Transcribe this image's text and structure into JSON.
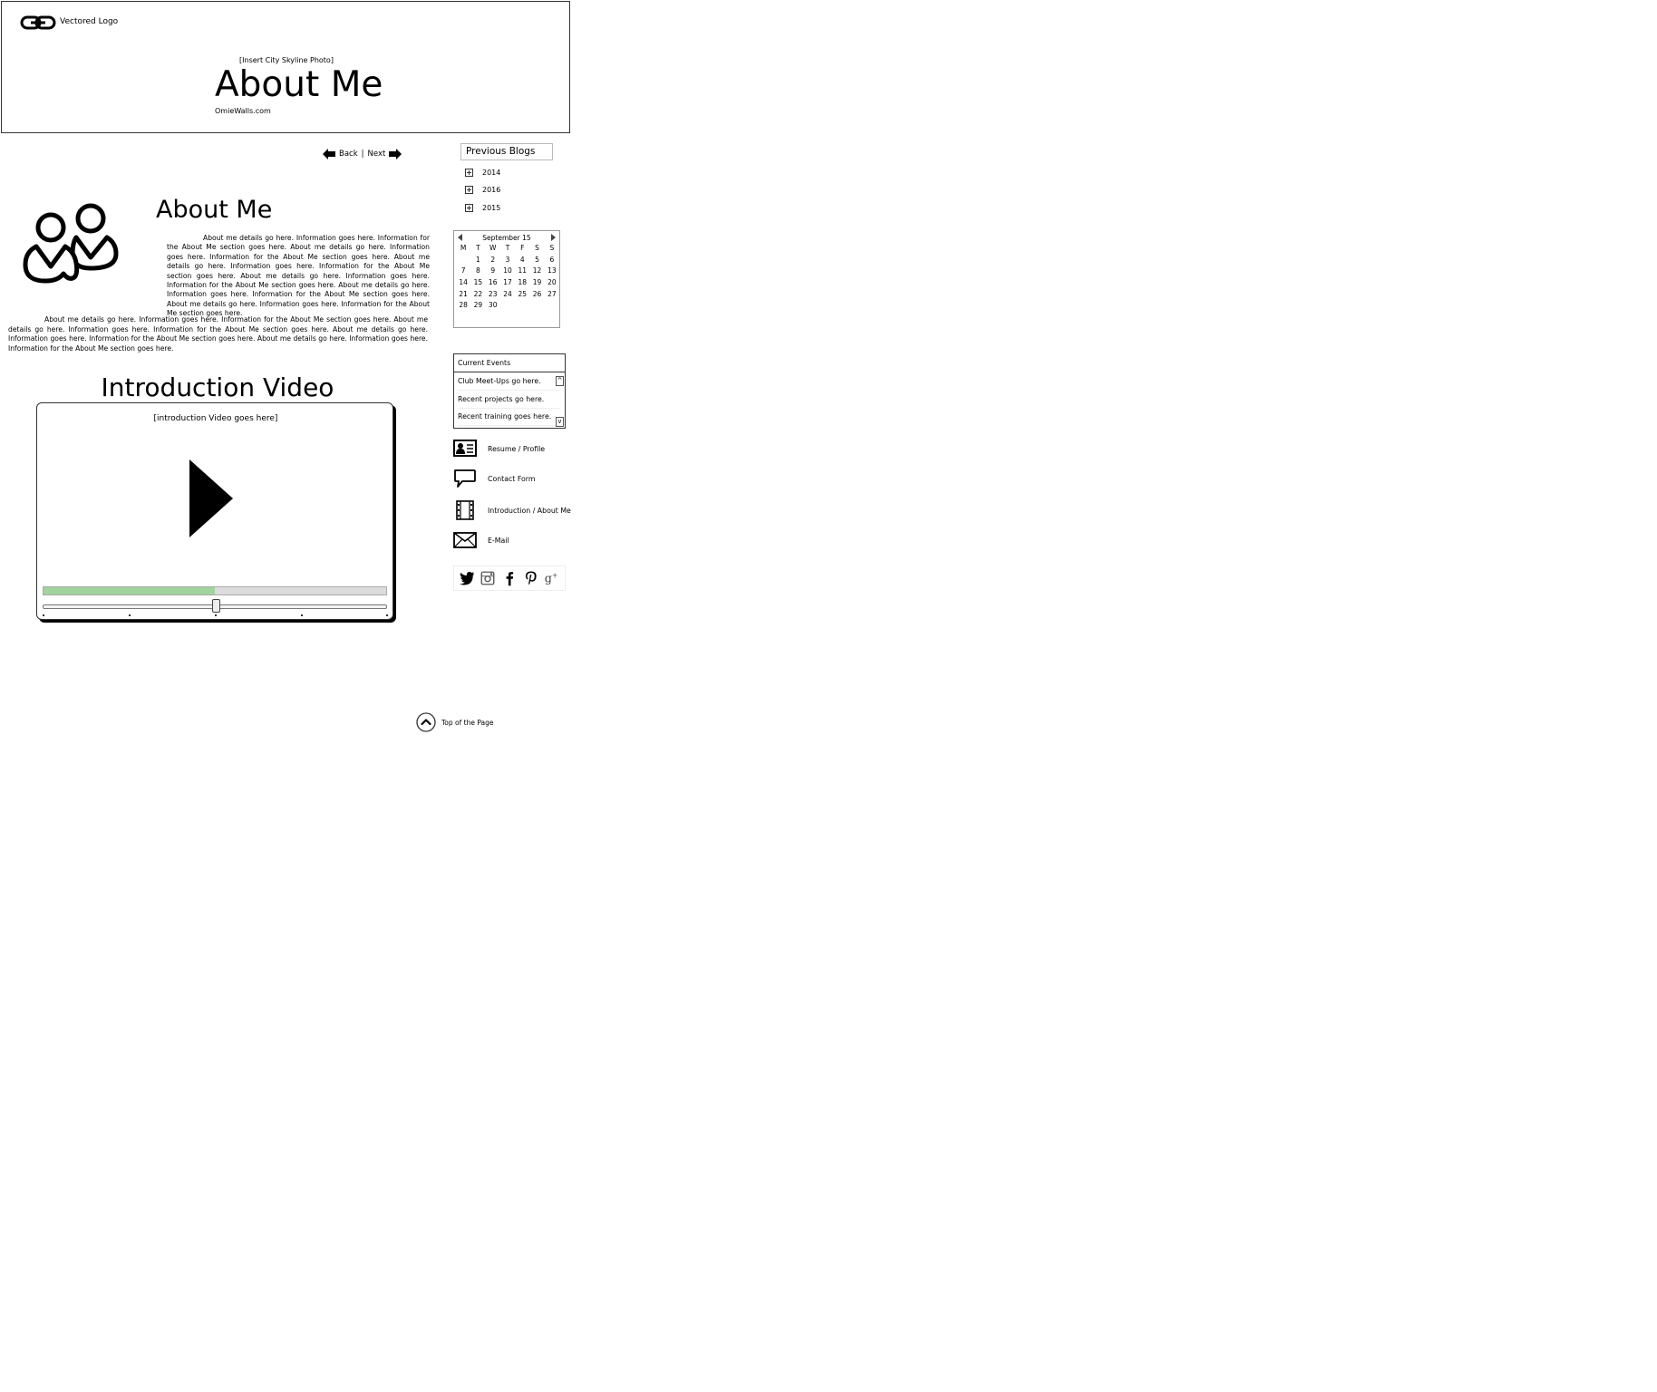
{
  "header": {
    "logo_label": "Vectored Logo",
    "skyline_note": "[Insert City Skyline Photo]",
    "title": "About Me",
    "site_url": "OmieWalls.com"
  },
  "pager": {
    "back_label": "Back",
    "separator": "|",
    "next_label": "Next"
  },
  "about": {
    "title": "About Me",
    "paragraph1": "About me details go here. Information goes here. Information for the About Me section goes here. About me details go here. Information goes here. Information for the About Me section goes here. About me details go here. Information goes here. Information for the About Me section goes here. About me details go here. Information goes here. Information for the About Me section goes here. About me details go here. Information goes here. Information for the About Me section goes here. About me details go here. Information goes here. Information for the About Me section goes here.",
    "paragraph2": "About me details go here. Information goes here. Information for the About Me section goes here. About me details go here. Information goes here. Information for the About Me section goes here. About me details go here. Information goes here. Information for the About Me section goes here. About me details go here. Information goes here. Information for the About Me section goes here."
  },
  "intro": {
    "title": "Introduction Video",
    "video_caption": "[introduction Video goes here]",
    "progress_fraction": 0.5
  },
  "sidebar": {
    "previous_blogs_label": "Previous Blogs",
    "years": [
      "2014",
      "2016",
      "2015"
    ],
    "calendar": {
      "month_label": "September 15",
      "weekdays": [
        "M",
        "T",
        "W",
        "T",
        "F",
        "S",
        "S"
      ],
      "days": [
        "",
        "1",
        "2",
        "3",
        "4",
        "5",
        "6",
        "7",
        "8",
        "9",
        "10",
        "11",
        "12",
        "13",
        "14",
        "15",
        "16",
        "17",
        "18",
        "19",
        "20",
        "21",
        "22",
        "23",
        "24",
        "25",
        "26",
        "27",
        "28",
        "29",
        "30"
      ]
    },
    "events": {
      "header": "Current Events",
      "items": [
        "Club Meet-Ups go here.",
        "Recent projects go here.",
        "Recent training goes here."
      ],
      "scroll_up": "^",
      "scroll_down": "v"
    },
    "links": [
      {
        "label": "Resume / Profile",
        "icon": "id-card-icon"
      },
      {
        "label": "Contact Form",
        "icon": "speech-bubble-icon"
      },
      {
        "label": "Introduction / About Me",
        "icon": "film-strip-icon"
      },
      {
        "label": "E-Mail",
        "icon": "envelope-icon"
      }
    ],
    "social": [
      "twitter-icon",
      "instagram-icon",
      "facebook-icon",
      "pinterest-icon",
      "google-plus-icon"
    ]
  },
  "footer": {
    "top_label": "Top of the Page"
  }
}
